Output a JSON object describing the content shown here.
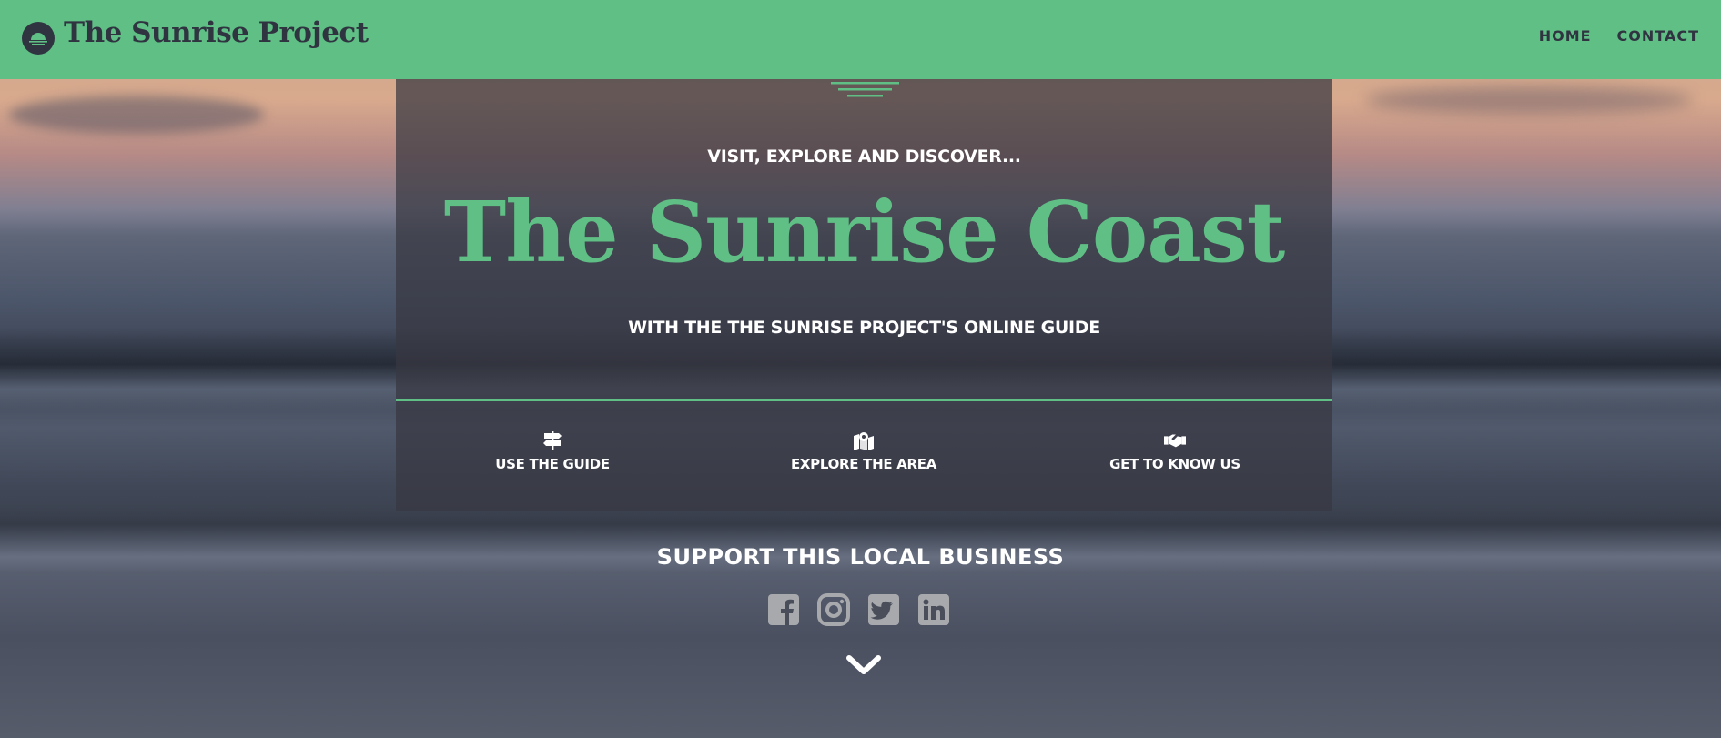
{
  "header": {
    "brand": "The Sunrise Project",
    "logo_icon": "sunrise-logo-icon",
    "nav": [
      {
        "label": "HOME"
      },
      {
        "label": "CONTACT"
      }
    ]
  },
  "hero": {
    "sun_icon": "sun-lines-icon",
    "visit_prefix": "VISIT, EXPLORE AND ",
    "visit_emphasis": "DISCOVER...",
    "title": "The Sunrise Coast",
    "subtitle_prefix": "WITH THE ",
    "subtitle_emphasis": "THE SUNRISE PROJECT'S ONLINE GUIDE",
    "actions": [
      {
        "icon": "signpost-icon",
        "label": "USE THE GUIDE"
      },
      {
        "icon": "map-marker-icon",
        "label": "EXPLORE THE AREA"
      },
      {
        "icon": "handshake-icon",
        "label": "GET TO KNOW US"
      }
    ]
  },
  "support": {
    "heading": "SUPPORT THIS LOCAL BUSINESS",
    "socials": [
      {
        "icon": "facebook-icon"
      },
      {
        "icon": "instagram-icon"
      },
      {
        "icon": "twitter-icon"
      },
      {
        "icon": "linkedin-icon"
      }
    ],
    "scroll_icon": "chevron-down-icon"
  },
  "colors": {
    "accent": "#5fbf85",
    "dark": "#2f3440",
    "text": "#ffffff",
    "social_gray": "#a7a9ad"
  }
}
